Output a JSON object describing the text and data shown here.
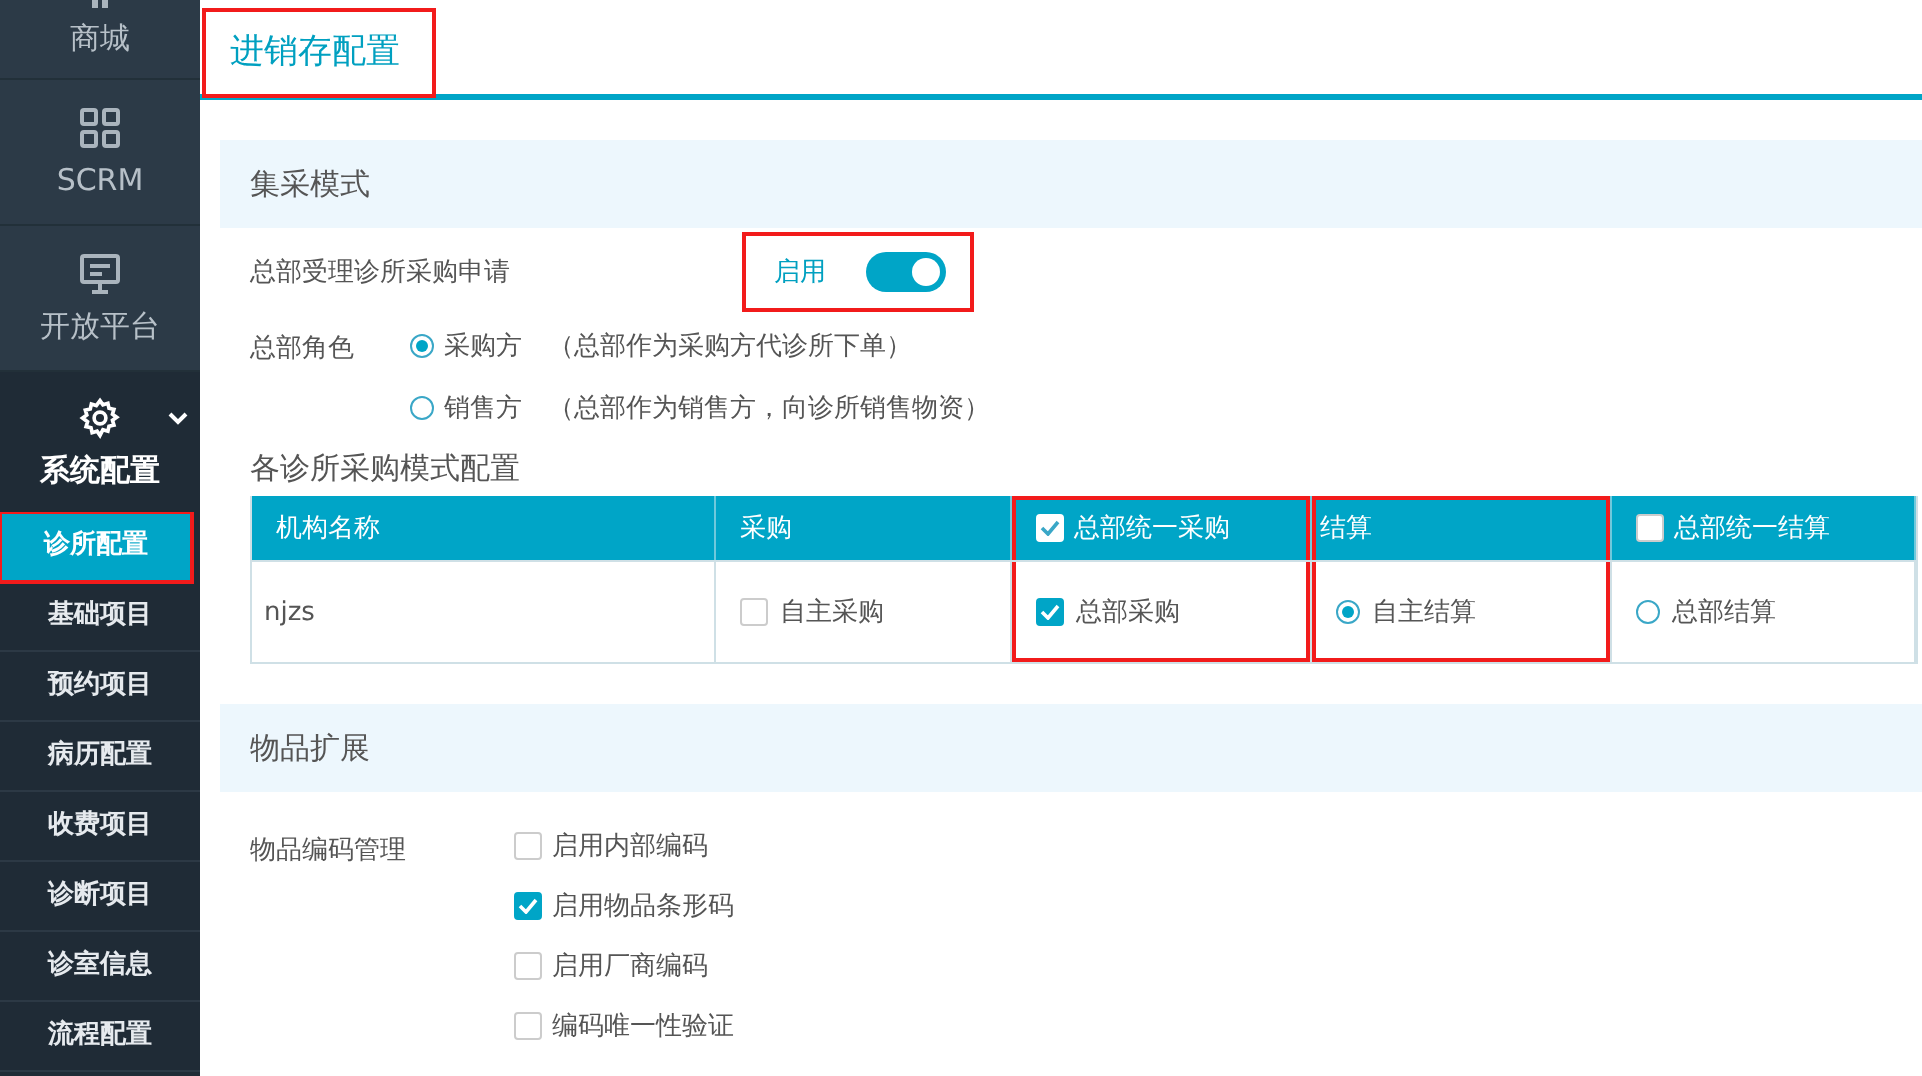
{
  "sidebar": {
    "items": [
      {
        "label": "商城",
        "kind": "partial",
        "expanded": false
      },
      {
        "label": "SCRM",
        "kind": "grid",
        "expanded": false
      },
      {
        "label": "开放平台",
        "kind": "monitor",
        "expanded": false
      },
      {
        "label": "系统配置",
        "kind": "gear",
        "expanded": true,
        "children": [
          {
            "label": "诊所配置",
            "selected": true,
            "highlighted": true
          },
          {
            "label": "基础项目",
            "selected": false,
            "highlighted": false
          },
          {
            "label": "预约项目",
            "selected": false,
            "highlighted": false
          },
          {
            "label": "病历配置",
            "selected": false,
            "highlighted": false
          },
          {
            "label": "收费项目",
            "selected": false,
            "highlighted": false
          },
          {
            "label": "诊断项目",
            "selected": false,
            "highlighted": false
          },
          {
            "label": "诊室信息",
            "selected": false,
            "highlighted": false
          },
          {
            "label": "流程配置",
            "selected": false,
            "highlighted": false
          }
        ]
      }
    ]
  },
  "page_title": {
    "text": "进销存配置",
    "highlighted": true
  },
  "procurement": {
    "title": "集采模式",
    "accept_request": {
      "label": "总部受理诊所采购申请",
      "state_text": "启用",
      "on": true,
      "highlighted": true
    },
    "hq_role": {
      "label": "总部角色",
      "options": [
        {
          "label": "采购方",
          "note": "（总部作为采购方代诊所下单）",
          "selected": true
        },
        {
          "label": "销售方",
          "note": "（总部作为销售方，向诊所销售物资）",
          "selected": false
        }
      ]
    },
    "table": {
      "title": "各诊所采购模式配置",
      "columns": [
        {
          "label": "机构名称",
          "kind": "text",
          "highlighted": false
        },
        {
          "label": "采购",
          "kind": "text",
          "highlighted": false
        },
        {
          "label": "总部统一采购",
          "kind": "checkbox",
          "checked": true,
          "highlighted": true
        },
        {
          "label": "结算",
          "kind": "text",
          "highlighted": true
        },
        {
          "label": "总部统一结算",
          "kind": "checkbox",
          "checked": false,
          "highlighted": false
        }
      ],
      "rows": [
        {
          "cells": [
            {
              "kind": "text",
              "text": "njzs"
            },
            {
              "kind": "checkbox",
              "label": "自主采购",
              "checked": false
            },
            {
              "kind": "checkbox",
              "label": "总部采购",
              "checked": true
            },
            {
              "kind": "radio",
              "label": "自主结算",
              "selected": true
            },
            {
              "kind": "radio",
              "label": "总部结算",
              "selected": false
            }
          ]
        }
      ]
    }
  },
  "item_extension": {
    "title": "物品扩展",
    "coding": {
      "label": "物品编码管理",
      "options": [
        {
          "label": "启用内部编码",
          "checked": false
        },
        {
          "label": "启用物品条形码",
          "checked": true
        },
        {
          "label": "启用厂商编码",
          "checked": false
        },
        {
          "label": "编码唯一性验证",
          "checked": false
        }
      ]
    }
  }
}
